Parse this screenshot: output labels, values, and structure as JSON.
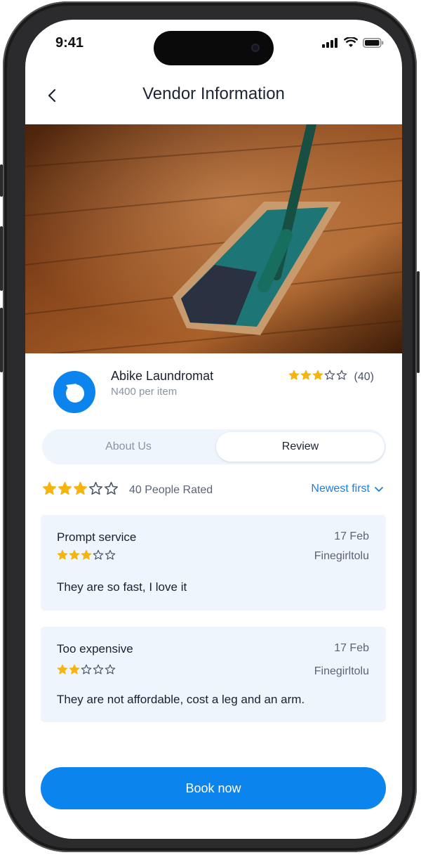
{
  "status": {
    "time": "9:41"
  },
  "header": {
    "title": "Vendor Information"
  },
  "vendor": {
    "name": "Abike Laundromat",
    "price": "N400 per item",
    "rating": 3,
    "rating_count": "(40)"
  },
  "tabs": [
    {
      "label": "About Us",
      "active": false
    },
    {
      "label": "Review",
      "active": true
    }
  ],
  "summary": {
    "rating": 3,
    "text": "40 People Rated",
    "sort_label": "Newest first"
  },
  "reviews": [
    {
      "title": "Prompt service",
      "date": "17 Feb",
      "user": "Finegirltolu",
      "rating": 3,
      "text": "They are so fast, I love it"
    },
    {
      "title": "Too expensive",
      "date": "17 Feb",
      "user": "Finegirltolu",
      "rating": 2,
      "text": "They are not affordable, cost a leg and an arm."
    }
  ],
  "book_button": "Book now",
  "colors": {
    "accent": "#0b84ee",
    "star": "#f5b40f",
    "card_bg": "#eef5fd"
  }
}
